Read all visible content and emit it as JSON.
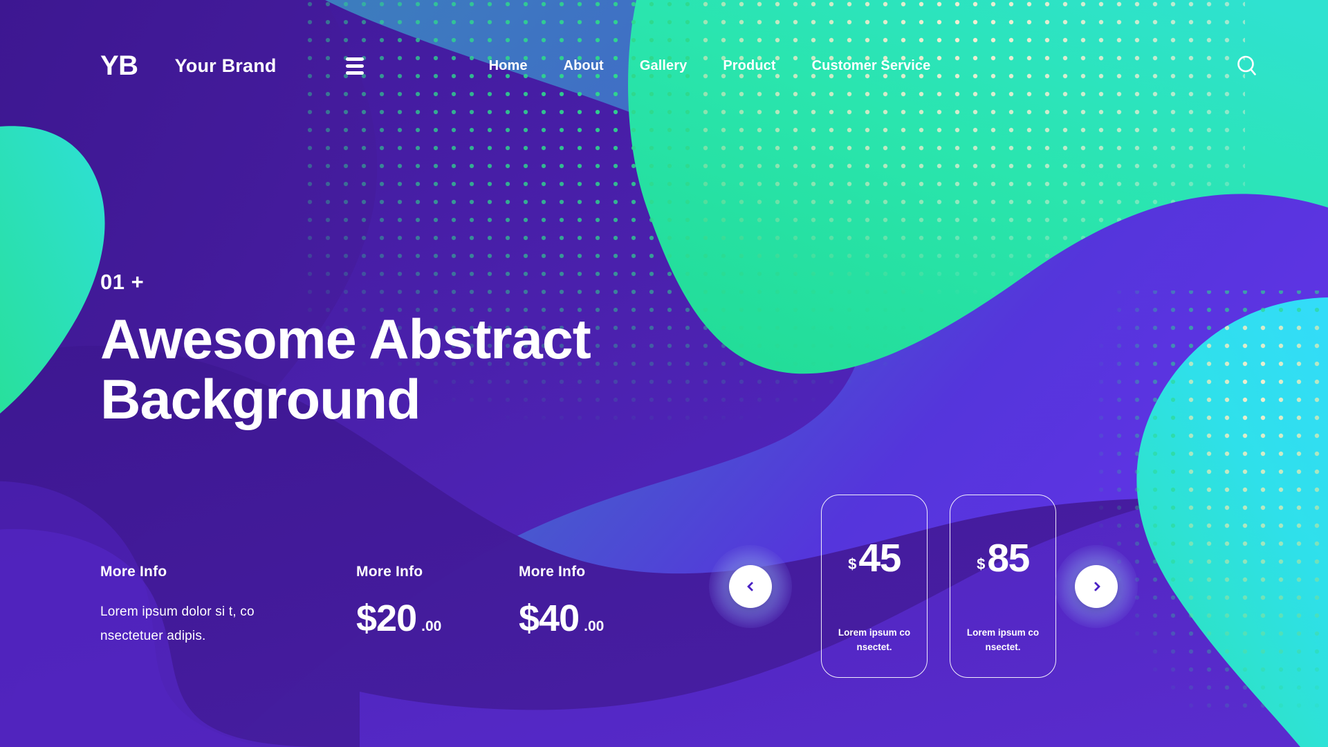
{
  "brand": {
    "logo_mark": "YB",
    "name": "Your Brand",
    "menu_icon": "hamburger-icon",
    "search_icon": "search-icon"
  },
  "nav": {
    "items": [
      {
        "label": "Home"
      },
      {
        "label": "About"
      },
      {
        "label": "Gallery"
      },
      {
        "label": "Product"
      },
      {
        "label": "Customer Service"
      }
    ]
  },
  "hero": {
    "eyebrow": "01 +",
    "title_line1": "Awesome Abstract",
    "title_line2": "Background"
  },
  "info_columns": [
    {
      "title": "More Info",
      "text_line1": "Lorem ipsum dolor si t, co",
      "text_line2": "nsectetuer adipis."
    },
    {
      "title": "More Info",
      "currency": "$",
      "amount": "20",
      "cents": ".00"
    },
    {
      "title": "More Info",
      "currency": "$",
      "amount": "40",
      "cents": ".00"
    }
  ],
  "carousel": {
    "prev_icon": "chevron-left-icon",
    "next_icon": "chevron-right-icon",
    "cards": [
      {
        "currency": "$",
        "amount": "45",
        "desc_line1": "Lorem ipsum co",
        "desc_line2": "nsectet."
      },
      {
        "currency": "$",
        "amount": "85",
        "desc_line1": "Lorem ipsum co",
        "desc_line2": "nsectet."
      }
    ]
  },
  "colors": {
    "purple_deep": "#4b20ab",
    "purple_dark": "#42199b",
    "purple_mid": "#5a2ad0",
    "violet_bright": "#6234e0",
    "blue_steel": "#3a7ab5",
    "teal_green": "#2ee6a0",
    "mint": "#2fe3a8",
    "cyan": "#2fe0f5",
    "cream_dot": "#f8efd4",
    "green_dot": "#33d98a",
    "white": "#ffffff"
  }
}
